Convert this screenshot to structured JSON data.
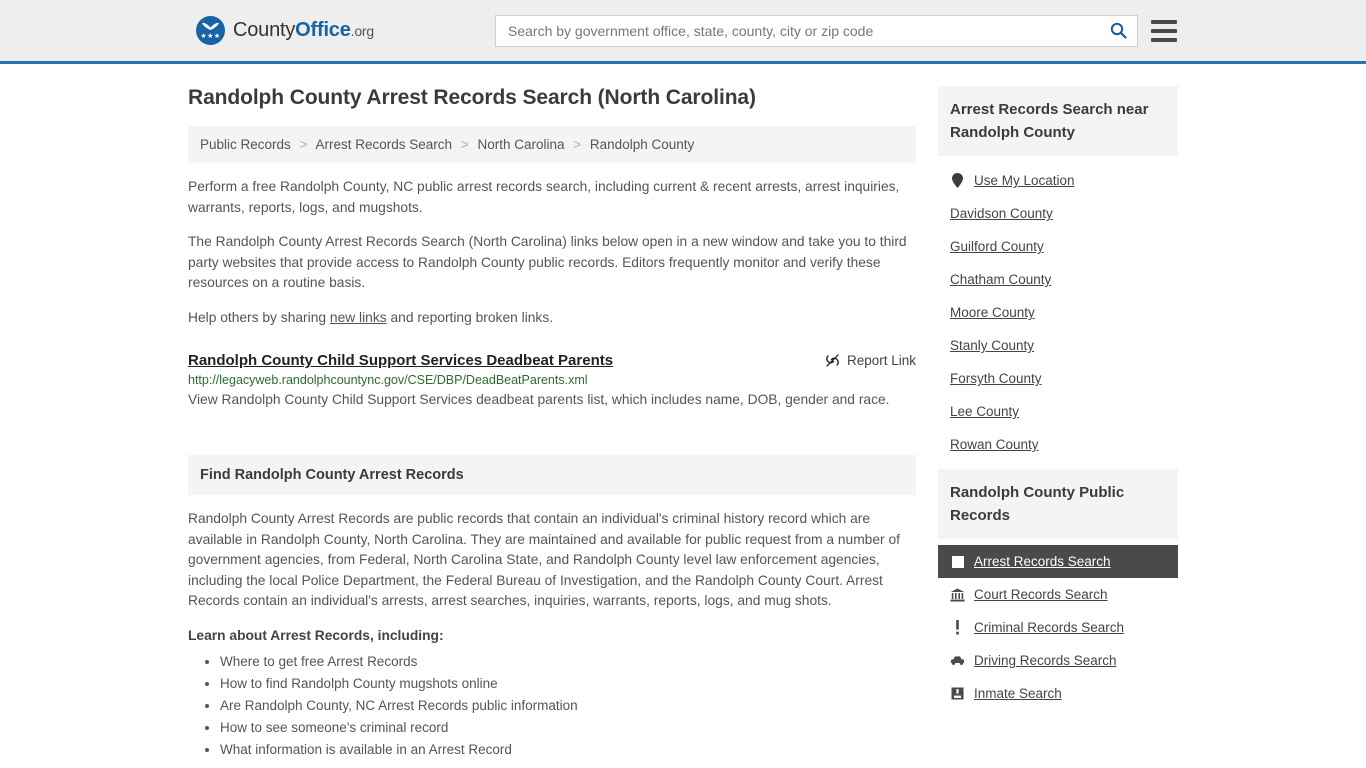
{
  "header": {
    "brand": {
      "part1": "County",
      "part2": "Office",
      "tld": ".org",
      "stars": "★★★"
    },
    "search": {
      "placeholder": "Search by government office, state, county, city or zip code",
      "value": "",
      "button_icon": "search-icon"
    },
    "menu_icon": "hamburger-menu-icon",
    "accent_color": "#2b74b4"
  },
  "main": {
    "title": "Randolph County Arrest Records Search (North Carolina)",
    "breadcrumb": [
      "Public Records",
      "Arrest Records Search",
      "North Carolina",
      "Randolph County"
    ],
    "breadcrumb_separator": ">",
    "intro_paragraph_1": "Perform a free Randolph County, NC public arrest records search, including current & recent arrests, arrest inquiries, warrants, reports, logs, and mugshots.",
    "intro_paragraph_2": "The Randolph County Arrest Records Search (North Carolina) links below open in a new window and take you to third party websites that provide access to Randolph County public records. Editors frequently monitor and verify these resources on a routine basis.",
    "help_prefix": "Help others by sharing ",
    "help_link": "new links",
    "help_suffix": " and reporting broken links.",
    "result": {
      "title": "Randolph County Child Support Services Deadbeat Parents",
      "report_label": "Report Link",
      "report_icon": "broken-link-icon",
      "url": "http://legacyweb.randolphcountync.gov/CSE/DBP/DeadBeatParents.xml",
      "description": "View Randolph County Child Support Services deadbeat parents list, which includes name, DOB, gender and race.",
      "url_color": "#2e6b2e"
    },
    "section": {
      "heading": "Find Randolph County Arrest Records",
      "paragraph": "Randolph County Arrest Records are public records that contain an individual's criminal history record which are available in Randolph County, North Carolina. They are maintained and available for public request from a number of government agencies, from Federal, North Carolina State, and Randolph County level law enforcement agencies, including the local Police Department, the Federal Bureau of Investigation, and the Randolph County Court. Arrest Records contain an individual's arrests, arrest searches, inquiries, warrants, reports, logs, and mug shots.",
      "learn_heading": "Learn about Arrest Records, including:",
      "learn_items": [
        "Where to get free Arrest Records",
        "How to find Randolph County mugshots online",
        "Are Randolph County, NC Arrest Records public information",
        "How to see someone's criminal record",
        "What information is available in an Arrest Record"
      ]
    }
  },
  "sidebar": {
    "near": {
      "heading": "Arrest Records Search near Randolph County",
      "items": [
        {
          "label": "Use My Location",
          "icon": "map-pin-icon"
        },
        {
          "label": "Davidson County",
          "icon": ""
        },
        {
          "label": "Guilford County",
          "icon": ""
        },
        {
          "label": "Chatham County",
          "icon": ""
        },
        {
          "label": "Moore County",
          "icon": ""
        },
        {
          "label": "Stanly County",
          "icon": ""
        },
        {
          "label": "Forsyth County",
          "icon": ""
        },
        {
          "label": "Lee County",
          "icon": ""
        },
        {
          "label": "Rowan County",
          "icon": ""
        }
      ]
    },
    "records": {
      "heading": "Randolph County Public Records",
      "items": [
        {
          "label": "Arrest Records Search",
          "icon": "white-square-icon",
          "active": true
        },
        {
          "label": "Court Records Search",
          "icon": "courthouse-icon",
          "active": false
        },
        {
          "label": "Criminal Records Search",
          "icon": "exclamation-icon",
          "active": false
        },
        {
          "label": "Driving Records Search",
          "icon": "car-icon",
          "active": false
        },
        {
          "label": "Inmate Search",
          "icon": "jail-icon",
          "active": false
        }
      ],
      "active_bg": "#4a4a4a"
    }
  }
}
